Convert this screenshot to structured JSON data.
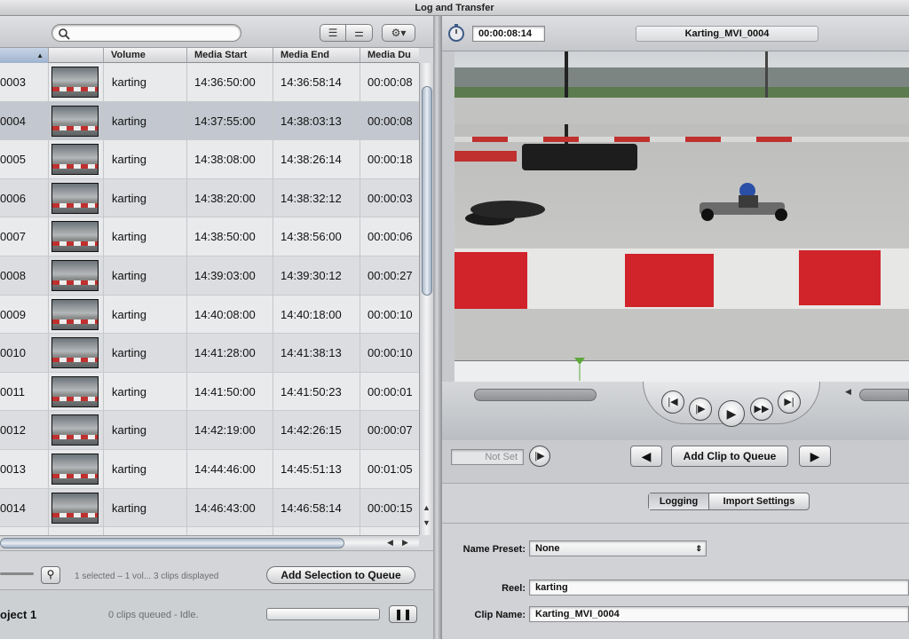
{
  "window": {
    "title": "Log and Transfer"
  },
  "browser": {
    "search_placeholder": "",
    "columns": [
      "Volume",
      "Media Start",
      "Media End",
      "Media Du"
    ],
    "rows": [
      {
        "name": "0003",
        "volume": "karting",
        "start": "14:36:50:00",
        "end": "14:36:58:14",
        "dur": "00:00:08"
      },
      {
        "name": "0004",
        "volume": "karting",
        "start": "14:37:55:00",
        "end": "14:38:03:13",
        "dur": "00:00:08"
      },
      {
        "name": "0005",
        "volume": "karting",
        "start": "14:38:08:00",
        "end": "14:38:26:14",
        "dur": "00:00:18"
      },
      {
        "name": "0006",
        "volume": "karting",
        "start": "14:38:20:00",
        "end": "14:38:32:12",
        "dur": "00:00:03"
      },
      {
        "name": "0007",
        "volume": "karting",
        "start": "14:38:50:00",
        "end": "14:38:56:00",
        "dur": "00:00:06"
      },
      {
        "name": "0008",
        "volume": "karting",
        "start": "14:39:03:00",
        "end": "14:39:30:12",
        "dur": "00:00:27"
      },
      {
        "name": "0009",
        "volume": "karting",
        "start": "14:40:08:00",
        "end": "14:40:18:00",
        "dur": "00:00:10"
      },
      {
        "name": "0010",
        "volume": "karting",
        "start": "14:41:28:00",
        "end": "14:41:38:13",
        "dur": "00:00:10"
      },
      {
        "name": "0011",
        "volume": "karting",
        "start": "14:41:50:00",
        "end": "14:41:50:23",
        "dur": "00:00:01"
      },
      {
        "name": "0012",
        "volume": "karting",
        "start": "14:42:19:00",
        "end": "14:42:26:15",
        "dur": "00:00:07"
      },
      {
        "name": "0013",
        "volume": "karting",
        "start": "14:44:46:00",
        "end": "14:45:51:13",
        "dur": "00:01:05"
      },
      {
        "name": "0014",
        "volume": "karting",
        "start": "14:46:43:00",
        "end": "14:46:58:14",
        "dur": "00:00:15"
      }
    ],
    "status": "1 selected – 1 vol... 3 clips displayed",
    "add_selection_label": "Add Selection to Queue",
    "project": "oject 1",
    "queue_status": "0 clips queued - Idle."
  },
  "viewer": {
    "timecode": "00:00:08:14",
    "clip_name": "Karting_MVI_0004",
    "in_point": "Not Set",
    "add_clip_label": "Add Clip to Queue"
  },
  "tabs": [
    {
      "label": "Logging"
    },
    {
      "label": "Import Settings"
    }
  ],
  "logging": {
    "name_preset_label": "Name Preset:",
    "name_preset_value": "None",
    "reel_label": "Reel:",
    "reel_value": "karting",
    "clip_name_label": "Clip Name:",
    "clip_name_value": "Karting_MVI_0004"
  },
  "colors": {
    "selection": "#c3c7cf",
    "kerb_red": "#c0302e"
  }
}
